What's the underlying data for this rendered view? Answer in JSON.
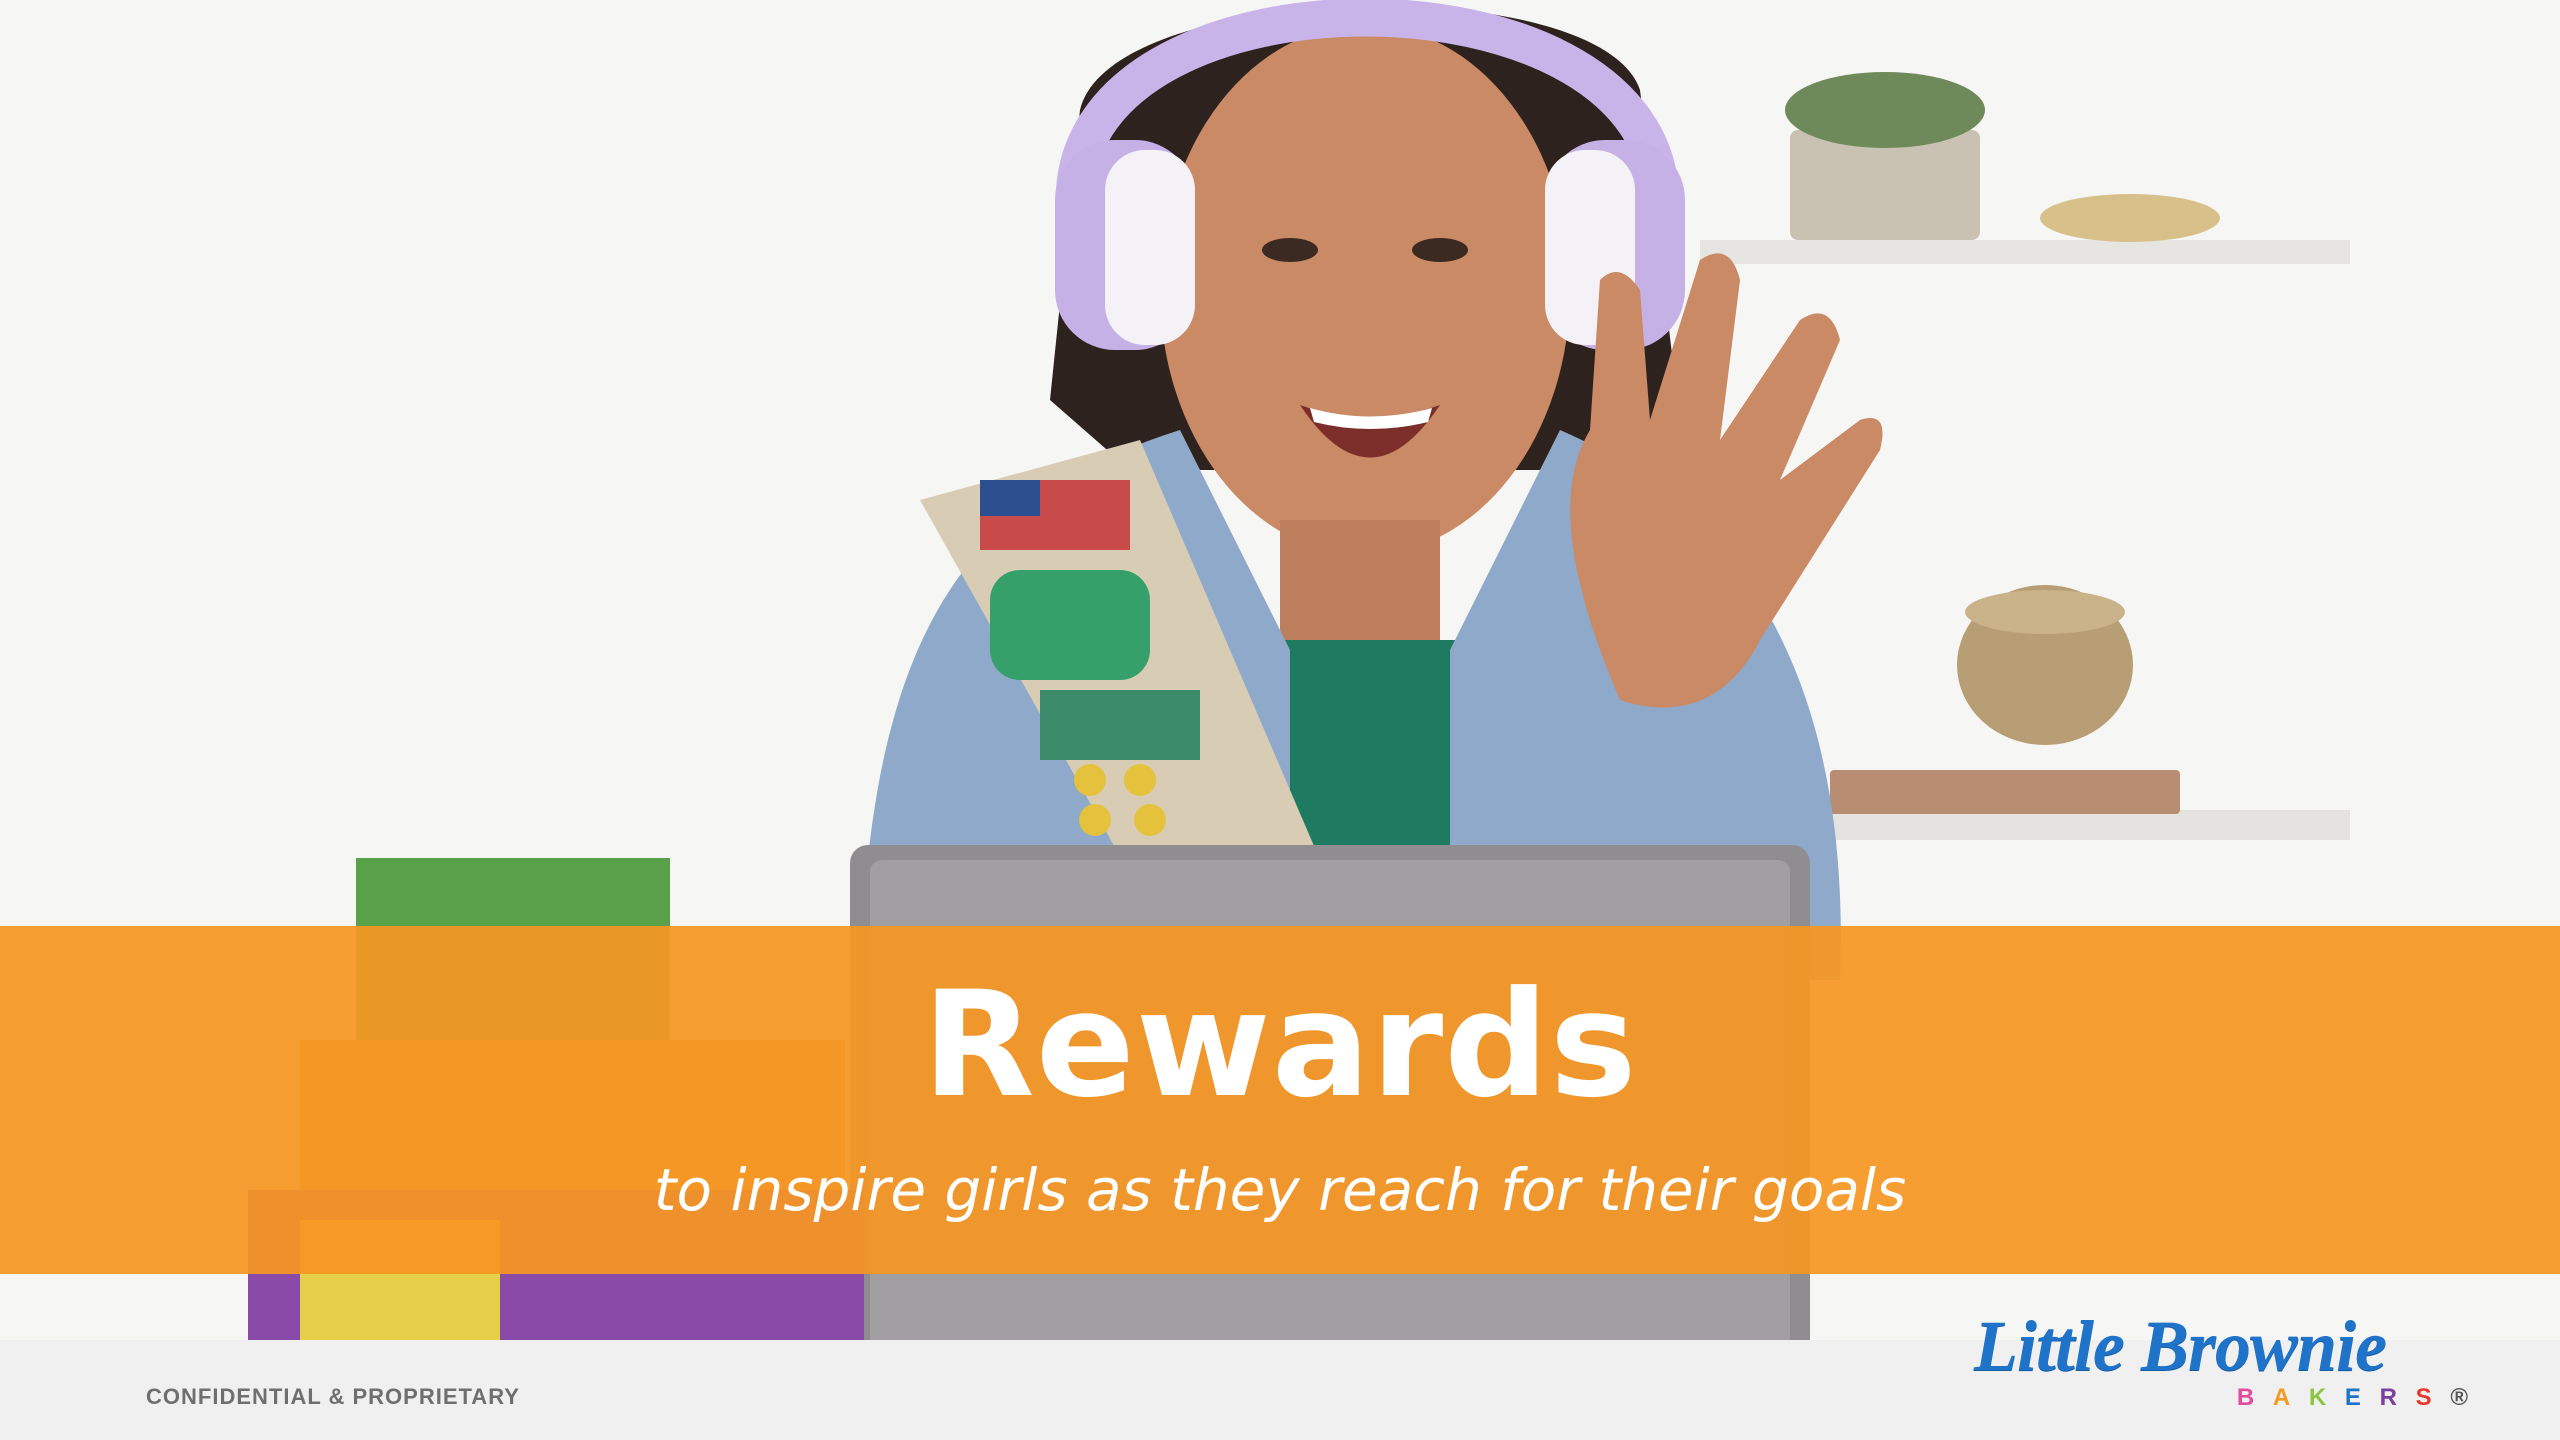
{
  "slide": {
    "title": "Rewards",
    "subtitle": "to inspire girls as they reach for their goals",
    "footer_label": "CONFIDENTIAL & PROPRIETARY",
    "logo": {
      "main_text": "Little Brownie",
      "sub_letters": [
        "B",
        "A",
        "K",
        "E",
        "R",
        "S",
        "®"
      ],
      "sub_colors": [
        "#e34b9c",
        "#f39a1f",
        "#8cc63f",
        "#1f74c9",
        "#7b3fa0",
        "#e8372c",
        "#555555"
      ]
    },
    "photo_description_icons": [
      "headphones-icon",
      "cookie-box-icon",
      "laptop-icon",
      "sash-icon"
    ],
    "colors": {
      "banner": "#f59722",
      "logo_blue": "#1f74c9",
      "footer_gray": "#6f6f6f"
    }
  }
}
